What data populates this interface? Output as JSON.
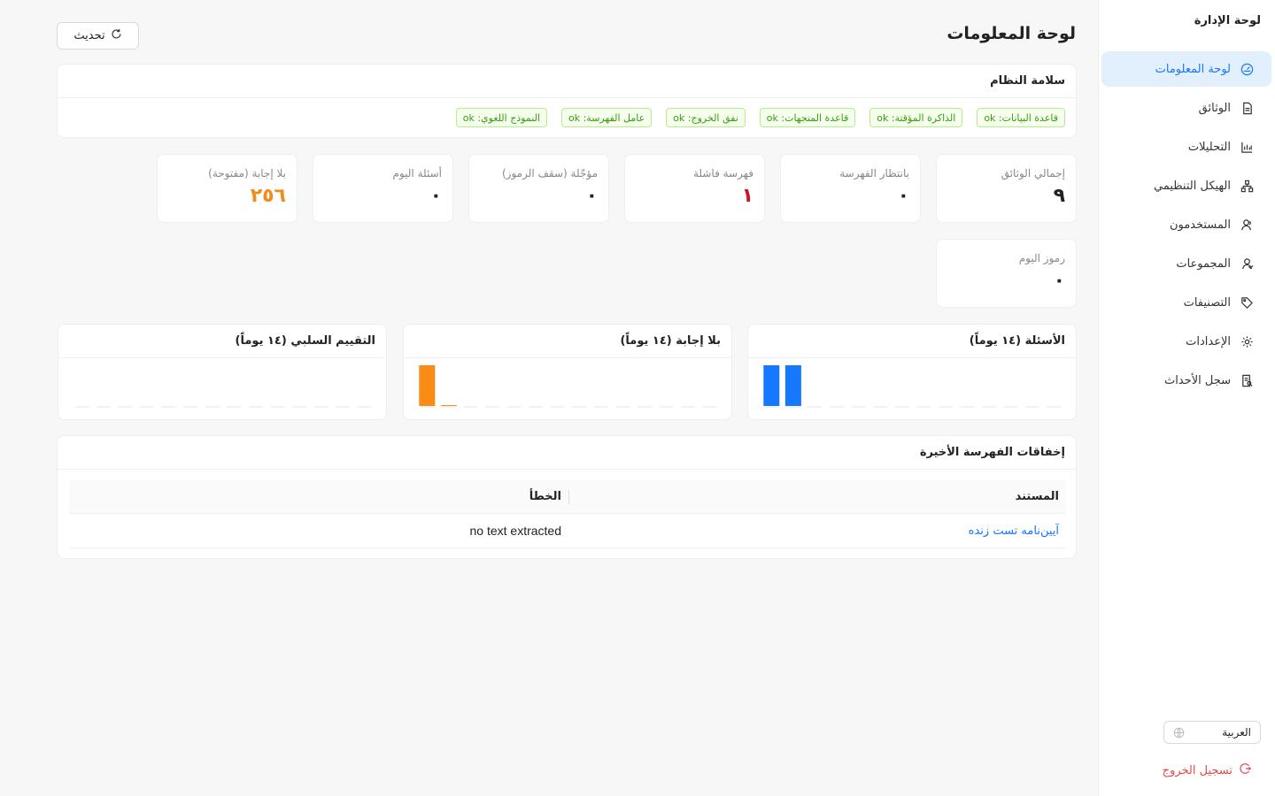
{
  "sidebar": {
    "title": "لوحة الإدارة",
    "items": [
      {
        "label": "لوحة المعلومات",
        "icon": "dashboard-icon",
        "active": true
      },
      {
        "label": "الوثائق",
        "icon": "document-icon",
        "active": false
      },
      {
        "label": "التحليلات",
        "icon": "bar-chart-icon",
        "active": false
      },
      {
        "label": "الهيكل التنظيمي",
        "icon": "org-chart-icon",
        "active": false
      },
      {
        "label": "المستخدمون",
        "icon": "users-icon",
        "active": false
      },
      {
        "label": "المجموعات",
        "icon": "group-icon",
        "active": false
      },
      {
        "label": "التصنيفات",
        "icon": "tag-icon",
        "active": false
      },
      {
        "label": "الإعدادات",
        "icon": "gear-icon",
        "active": false
      },
      {
        "label": "سجل الأحداث",
        "icon": "audit-log-icon",
        "active": false
      }
    ],
    "language": "العربية",
    "logout_label": "تسجيل الخروج"
  },
  "header": {
    "title": "لوحة المعلومات",
    "refresh_label": "تحديث"
  },
  "health": {
    "title": "سلامة النظام",
    "tags": [
      "قاعدة البيانات: ok",
      "الذاكرة المؤقتة: ok",
      "قاعدة المتجهات: ok",
      "نفق الخروج: ok",
      "عامل الفهرسة: ok",
      "النموذج اللغوي: ok"
    ]
  },
  "stats": [
    {
      "label": "إجمالي الوثائق",
      "value": "٩"
    },
    {
      "label": "بانتظار الفهرسة",
      "value": "٠"
    },
    {
      "label": "فهرسة فاشلة",
      "value": "١"
    },
    {
      "label": "مؤجّلة (سقف الرموز)",
      "value": "٠"
    },
    {
      "label": "أسئلة اليوم",
      "value": "٠"
    },
    {
      "label": "بلا إجابة (مفتوحة)",
      "value": "٢٥٦"
    },
    {
      "label": "رموز اليوم",
      "value": "٠"
    }
  ],
  "colors": {
    "accent": "#1677ff",
    "danger": "#cf1322",
    "warning": "#f08c1e",
    "chart_blue": "#1677ff",
    "chart_orange": "#fa8c16",
    "ok_green": "#389e0d"
  },
  "charts": {
    "questions_title": "الأسئلة (١٤ يوماً)",
    "unanswered_title": "بلا إجابة (١٤ يوماً)",
    "negative_title": "التقييم السلبي (١٤ يوماً)"
  },
  "chart_data": [
    {
      "type": "bar",
      "title": "الأسئلة (١٤ يوماً)",
      "color": "#1677ff",
      "values": [
        1,
        1,
        0,
        0,
        0,
        0,
        0,
        0,
        0,
        0,
        0,
        0,
        0,
        0
      ]
    },
    {
      "type": "bar",
      "title": "بلا إجابة (١٤ يوماً)",
      "color": "#fa8c16",
      "values": [
        1,
        0.02,
        0,
        0,
        0,
        0,
        0,
        0,
        0,
        0,
        0,
        0,
        0,
        0
      ]
    },
    {
      "type": "bar",
      "title": "التقييم السلبي (١٤ يوماً)",
      "color": "#fa8c16",
      "values": [
        0,
        0,
        0,
        0,
        0,
        0,
        0,
        0,
        0,
        0,
        0,
        0,
        0,
        0
      ]
    }
  ],
  "failures": {
    "title": "إخفاقات الفهرسة الأخيرة",
    "columns": [
      "المستند",
      "الخطأ"
    ],
    "rows": [
      {
        "document": "آیین‌نامه تست زنده",
        "error": "no text extracted"
      }
    ]
  }
}
